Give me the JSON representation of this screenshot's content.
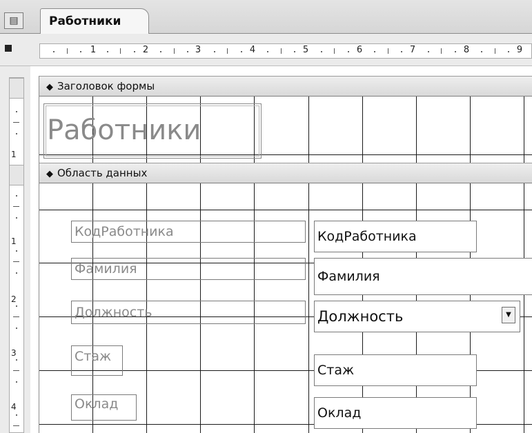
{
  "tab": {
    "title": "Работники",
    "icon": "form-icon"
  },
  "ruler": {
    "horizontal_numbers": [
      "1",
      "2",
      "3",
      "4",
      "5",
      "6",
      "7",
      "8",
      "9"
    ],
    "vertical_header_numbers": [
      "1"
    ],
    "vertical_detail_numbers": [
      "1",
      "2",
      "3",
      "4"
    ]
  },
  "sections": {
    "header": {
      "label": "Заголовок формы",
      "form_title": "Работники"
    },
    "detail": {
      "label": "Область данных"
    }
  },
  "controls": [
    {
      "label": "КодРаботника",
      "field": "КодРаботника"
    },
    {
      "label": "Фамилия",
      "field": "Фамилия"
    },
    {
      "label": "Должность",
      "field": "Должность",
      "type": "combobox"
    },
    {
      "label": "Стаж",
      "field": "Стаж"
    },
    {
      "label": "Оклад",
      "field": "Оклад"
    }
  ]
}
